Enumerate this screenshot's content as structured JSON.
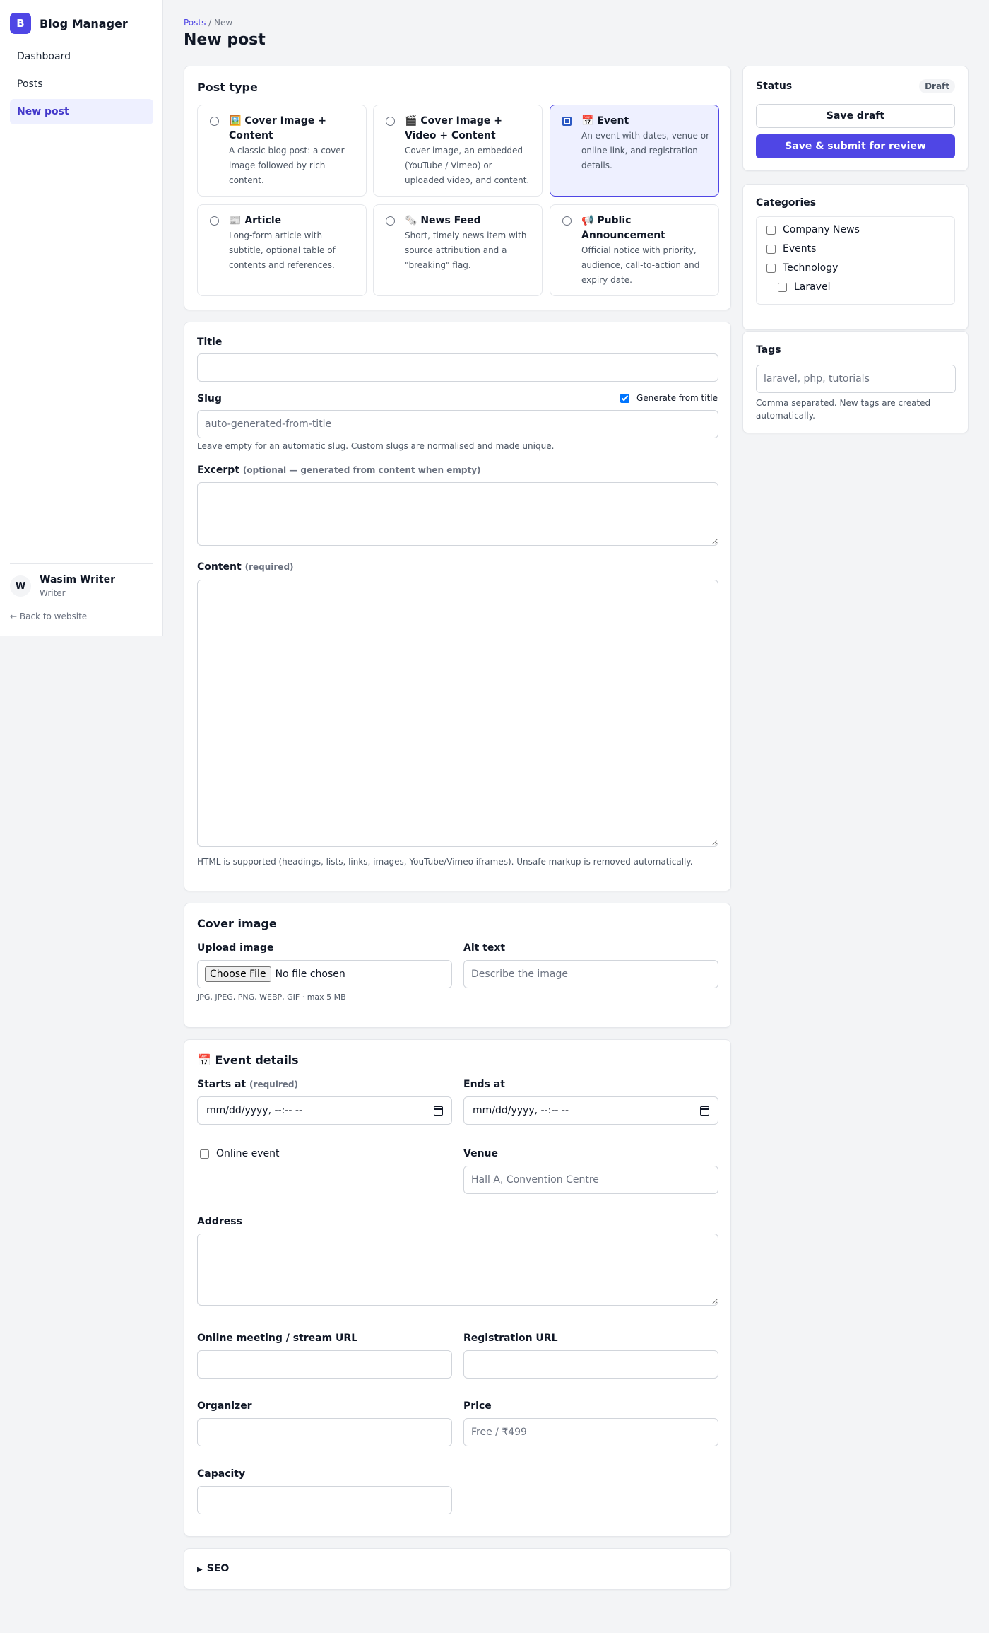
{
  "app": {
    "logo_letter": "B",
    "name": "Blog Manager"
  },
  "nav": [
    {
      "label": "Dashboard",
      "active": false
    },
    {
      "label": "Posts",
      "active": false
    },
    {
      "label": "New post",
      "active": true
    }
  ],
  "user": {
    "initial": "W",
    "name": "Wasim Writer",
    "role": "Writer",
    "back_link": "← Back to website"
  },
  "breadcrumb": {
    "link": "Posts",
    "separator": " / ",
    "current": "New"
  },
  "page_title": "New post",
  "post_type": {
    "title": "Post type",
    "options": [
      {
        "icon": "🖼️",
        "label": "Cover Image + Content",
        "desc": "A classic blog post: a cover image followed by rich content.",
        "selected": false
      },
      {
        "icon": "🎬",
        "label": "Cover Image + Video + Content",
        "desc": "Cover image, an embedded (YouTube / Vimeo) or uploaded video, and content.",
        "selected": false
      },
      {
        "icon": "📅",
        "label": "Event",
        "desc": "An event with dates, venue or online link, and registration details.",
        "selected": true
      },
      {
        "icon": "📰",
        "label": "Article",
        "desc": "Long-form article with subtitle, optional table of contents and references.",
        "selected": false
      },
      {
        "icon": "🗞️",
        "label": "News Feed",
        "desc": "Short, timely news item with source attribution and a \"breaking\" flag.",
        "selected": false
      },
      {
        "icon": "📢",
        "label": "Public Announcement",
        "desc": "Official notice with priority, audience, call-to-action and expiry date.",
        "selected": false
      }
    ]
  },
  "main_fields": {
    "title_label": "Title",
    "title_value": "",
    "slug_label": "Slug",
    "slug_generate_label": "Generate from title",
    "slug_generate_checked": true,
    "slug_placeholder": "auto-generated-from-title",
    "slug_help": "Leave empty for an automatic slug. Custom slugs are normalised and made unique.",
    "excerpt_label": "Excerpt",
    "excerpt_note": "(optional — generated from content when empty)",
    "content_label": "Content",
    "content_note": "(required)",
    "content_help": "HTML is supported (headings, lists, links, images, YouTube/Vimeo iframes). Unsafe markup is removed automatically."
  },
  "cover_image": {
    "title": "Cover image",
    "upload_label": "Upload image",
    "file_button": "Choose File",
    "file_status": "No file chosen",
    "upload_help": "JPG, JPEG, PNG, WEBP, GIF · max 5 MB",
    "alt_label": "Alt text",
    "alt_placeholder": "Describe the image"
  },
  "event_details": {
    "icon": "📅",
    "title": "Event details",
    "starts_label": "Starts at",
    "starts_note": "(required)",
    "starts_value": "mm/dd/yyyy, --:-- --",
    "ends_label": "Ends at",
    "ends_value": "mm/dd/yyyy, --:-- --",
    "online_label": "Online event",
    "online_checked": false,
    "venue_label": "Venue",
    "venue_placeholder": "Hall A, Convention Centre",
    "address_label": "Address",
    "meeting_label": "Online meeting / stream URL",
    "registration_label": "Registration URL",
    "organizer_label": "Organizer",
    "price_label": "Price",
    "price_placeholder": "Free / ₹499",
    "capacity_label": "Capacity"
  },
  "seo": {
    "label": "SEO",
    "icon": "▶"
  },
  "status_panel": {
    "title": "Status",
    "badge": "Draft",
    "save_draft": "Save draft",
    "submit": "Save & submit for review"
  },
  "categories": {
    "title": "Categories",
    "items": [
      {
        "label": "Company News",
        "checked": false,
        "child": false
      },
      {
        "label": "Events",
        "checked": false,
        "child": false
      },
      {
        "label": "Technology",
        "checked": false,
        "child": false
      },
      {
        "label": "Laravel",
        "checked": false,
        "child": true
      }
    ]
  },
  "tags": {
    "title": "Tags",
    "placeholder": "laravel, php, tutorials",
    "help": "Comma separated. New tags are created automatically."
  },
  "colors": {
    "accent": "#4f46e5",
    "selected_bg": "#eef0ff",
    "page_bg": "#f3f4f6"
  }
}
